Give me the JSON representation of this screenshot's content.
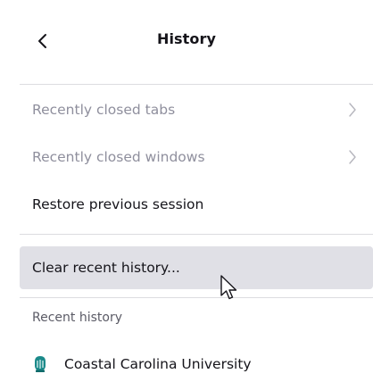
{
  "header": {
    "back_icon": "chevron-left-icon",
    "title": "History"
  },
  "menu": {
    "recently_closed_tabs": "Recently closed tabs",
    "recently_closed_windows": "Recently closed windows",
    "restore_previous_session": "Restore previous session",
    "clear_recent_history": "Clear recent history..."
  },
  "recent_history": {
    "label": "Recent history",
    "items": [
      {
        "title": "Coastal Carolina University",
        "icon": "site-favicon-icon"
      }
    ]
  },
  "colors": {
    "disabled_text": "#8f8f9d",
    "hover_background": "#e0e0e6",
    "favicon_teal": "#1b8a8a"
  }
}
